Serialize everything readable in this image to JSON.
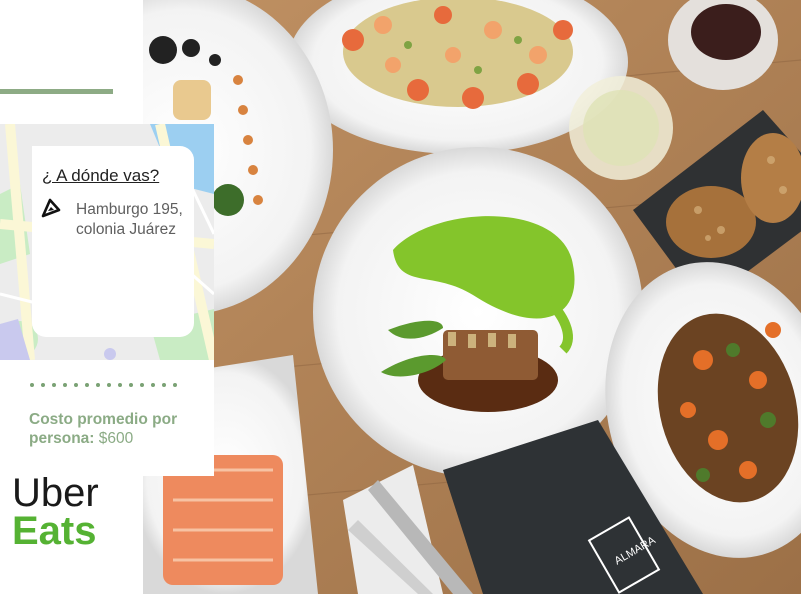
{
  "card": {
    "question": "¿ A dónde vas?",
    "address": "Hamburgo 195, colonia Juárez"
  },
  "cost": {
    "label": "Costo promedio por persona:",
    "price": "$600"
  },
  "logo": {
    "line1": "Uber",
    "line2": "Eats"
  },
  "photo": {
    "menu_text": "ALMARA"
  },
  "colors": {
    "accent_green": "#8dab85",
    "eats_green": "#55b233",
    "map_blue": "#9ccff1"
  },
  "icons": [
    "navigation-arrow-icon"
  ]
}
